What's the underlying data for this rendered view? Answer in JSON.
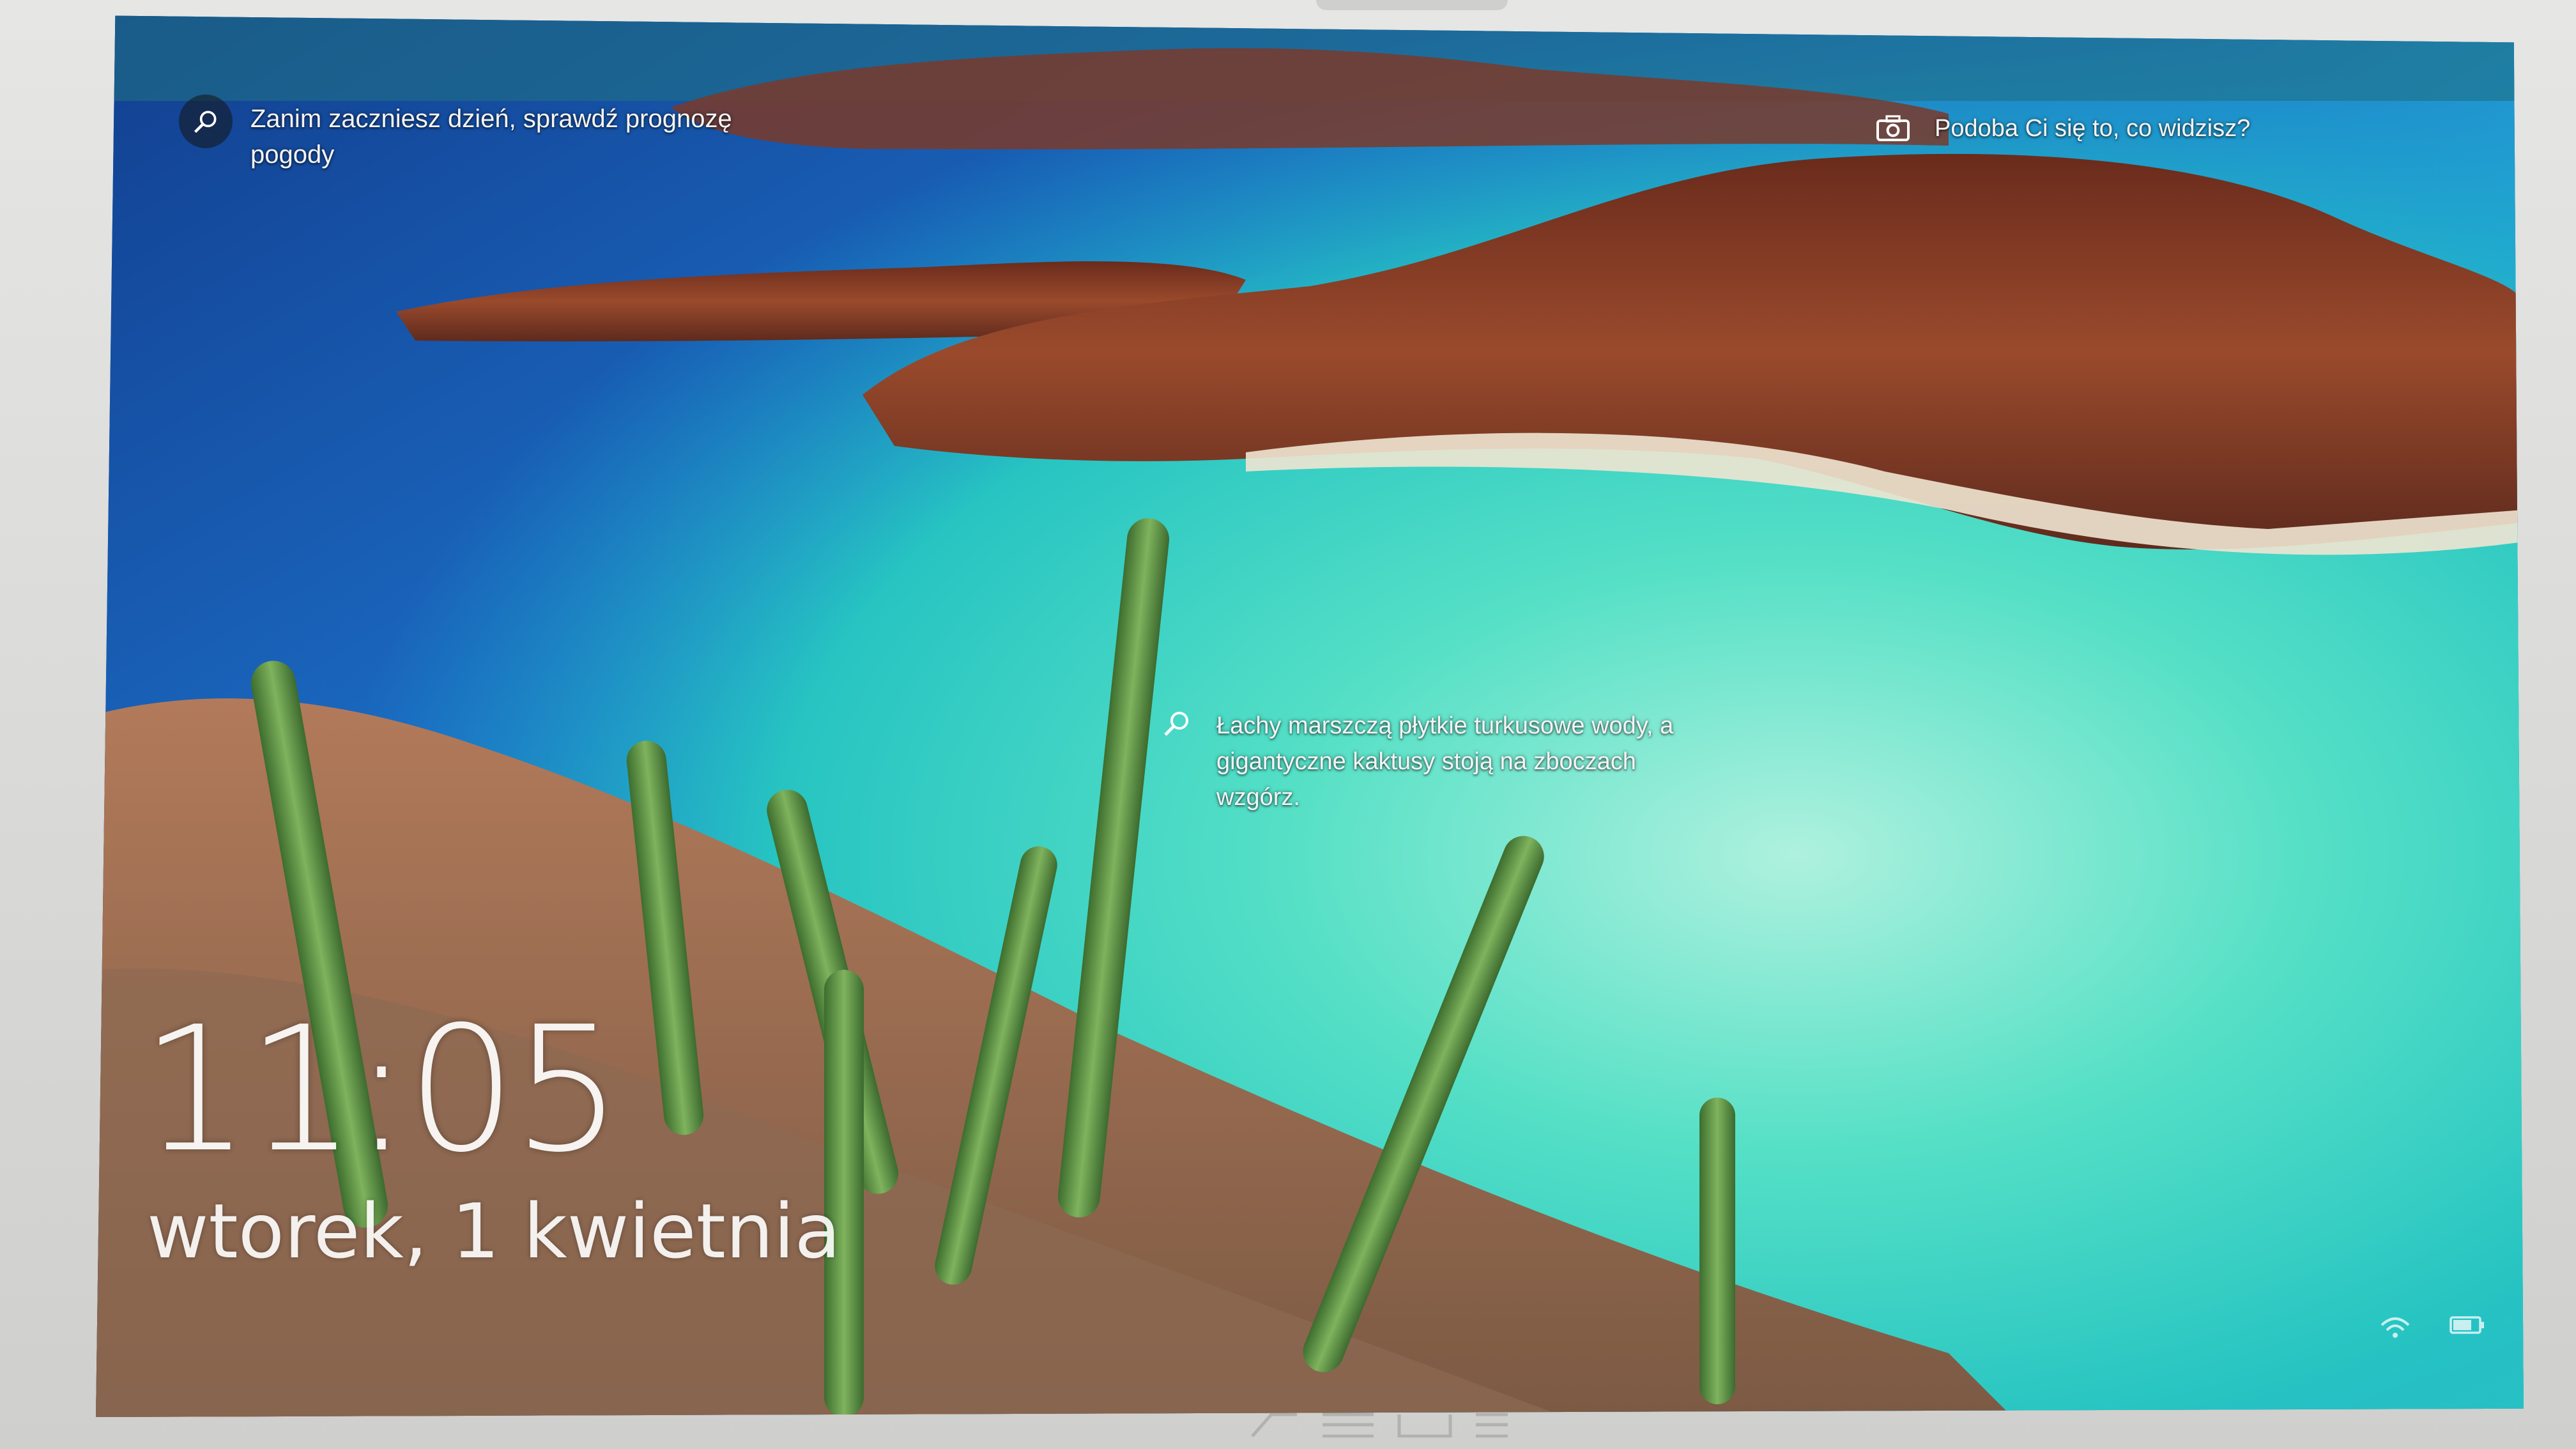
{
  "lock_screen": {
    "weather_prompt": "Zanim zaczniesz dzień, sprawdź prognozę pogody",
    "feedback_prompt": "Podoba Ci się to, co widzisz?",
    "image_caption": "Łachy marszczą płytkie turkusowe wody, a gigantyczne kaktusy stoją na zboczach wzgórz.",
    "time": "11:05",
    "date": "wtorek, 1 kwietnia",
    "icons": {
      "weather": "search-icon",
      "feedback": "camera-icon",
      "caption": "search-icon",
      "tray_network": "wifi-icon",
      "tray_battery": "battery-icon"
    }
  },
  "colors": {
    "sky_water_deep": "#1d5fb8",
    "lagoon_turquoise": "#3fd6c0",
    "hill_red": "#8a3b24",
    "cactus_green": "#4f8a3a",
    "text": "#f4f4f4"
  }
}
